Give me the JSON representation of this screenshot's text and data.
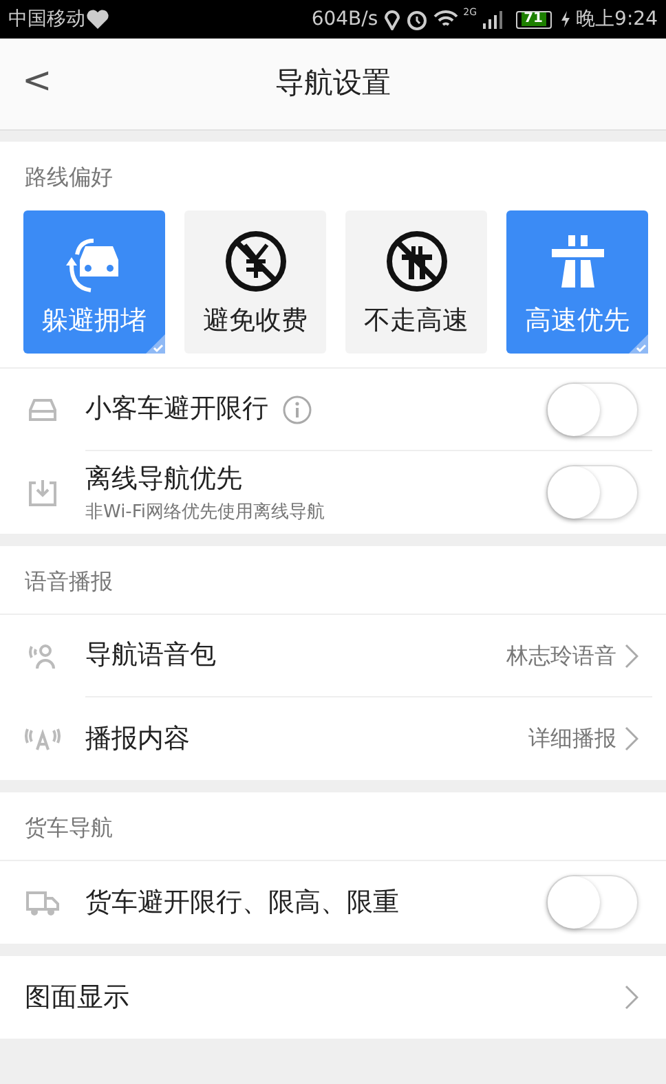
{
  "status_bar": {
    "carrier": "中国移动",
    "speed": "604B/s",
    "network": "2G",
    "battery": "71",
    "time": "晚上9:24"
  },
  "header": {
    "back": "<",
    "title": "导航设置"
  },
  "sections": [
    {
      "title": "路线偏好",
      "options": [
        {
          "label": "躲避拥堵",
          "selected": true
        },
        {
          "label": "避免收费",
          "selected": false
        },
        {
          "label": "不走高速",
          "selected": false
        },
        {
          "label": "高速优先",
          "selected": true
        }
      ],
      "rows": [
        {
          "kind": "toggle",
          "label": "小客车避开限行",
          "info": true,
          "on": false
        },
        {
          "kind": "toggle",
          "label": "离线导航优先",
          "subtitle": "非Wi-Fi网络优先使用离线导航",
          "on": false
        }
      ]
    },
    {
      "title": "语音播报",
      "rows": [
        {
          "kind": "link",
          "label": "导航语音包",
          "value": "林志玲语音"
        },
        {
          "kind": "link",
          "label": "播报内容",
          "value": "详细播报"
        }
      ]
    },
    {
      "title": "货车导航",
      "rows": [
        {
          "kind": "toggle",
          "label": "货车避开限行、限高、限重",
          "on": false
        }
      ]
    },
    {
      "rows": [
        {
          "kind": "link",
          "label": "图面显示"
        }
      ]
    }
  ]
}
